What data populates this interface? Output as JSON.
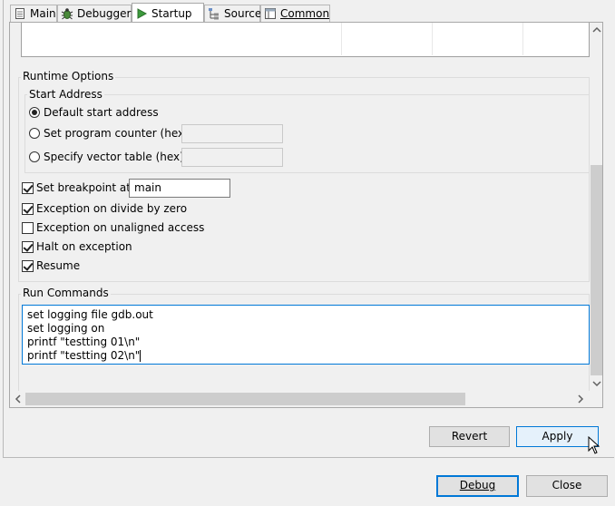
{
  "tabs": [
    {
      "label": "Main",
      "icon": "document-icon"
    },
    {
      "label": "Debugger",
      "icon": "bug-icon"
    },
    {
      "label": "Startup",
      "icon": "play-icon"
    },
    {
      "label": "Source",
      "icon": "source-lookup-icon"
    },
    {
      "label": "Common",
      "icon": "window-icon"
    }
  ],
  "active_tab": "Startup",
  "runtime_options": {
    "title": "Runtime Options",
    "start_address": {
      "title": "Start Address",
      "default_label": "Default start address",
      "program_counter_label": "Set program counter (hex):",
      "program_counter_value": "",
      "vector_table_label": "Specify vector table (hex):",
      "vector_table_value": "",
      "selected": "default"
    },
    "set_breakpoint": {
      "label": "Set breakpoint at:",
      "checked": true,
      "value": "main"
    },
    "exception_divide": {
      "label": "Exception on divide by zero",
      "checked": true
    },
    "exception_unaligned": {
      "label": "Exception on unaligned access",
      "checked": false
    },
    "halt_on_exception": {
      "label": "Halt on exception",
      "checked": true
    },
    "resume": {
      "label": "Resume",
      "checked": true
    }
  },
  "run_commands": {
    "title": "Run Commands",
    "lines": [
      "set logging file gdb.out",
      "set logging on",
      "printf \"testting 01\\n\"",
      "printf \"testting 02\\n\""
    ]
  },
  "buttons": {
    "revert": "Revert",
    "apply": "Apply",
    "debug": "Debug",
    "close": "Close"
  },
  "colors": {
    "accent": "#0078d7",
    "panel_bg": "#f0f0f0"
  }
}
